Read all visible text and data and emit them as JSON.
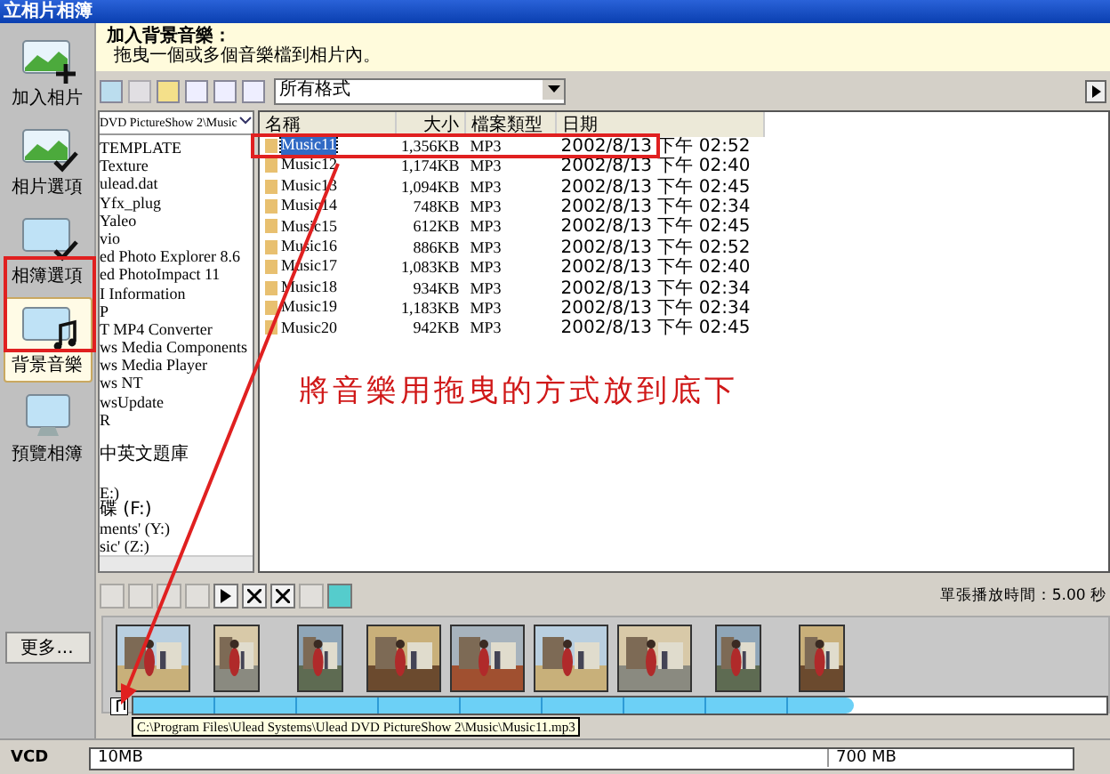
{
  "window": {
    "title": "立相片相簿"
  },
  "sidebar": {
    "items": [
      {
        "label": "加入相片",
        "selected": false
      },
      {
        "label": "相片選項",
        "selected": false
      },
      {
        "label": "相簿選項",
        "selected": false
      },
      {
        "label": "背景音樂",
        "selected": true
      },
      {
        "label": "預覽相簿",
        "selected": false
      }
    ],
    "more": "更多..."
  },
  "header": {
    "title": "加入背景音樂：",
    "hint": "拖曳一個或多個音樂檔到相片內。"
  },
  "format_filter": {
    "value": "所有格式"
  },
  "folder_tree": {
    "path": "DVD PictureShow 2\\Music",
    "items": [
      "TEMPLATE",
      "Texture",
      "ulead.dat",
      "Yfx_plug",
      "Yaleo",
      "vio",
      "ed Photo Explorer 8.6",
      "ed PhotoImpact 11",
      "I Information",
      "P",
      "T MP4 Converter",
      "ws Media Components",
      "ws Media Player",
      "ws NT",
      "wsUpdate",
      "R",
      "中英文題庫",
      "E:)",
      "碟 (F:)",
      "ments' (Y:)",
      "sic' (Z:)"
    ]
  },
  "file_list": {
    "columns": [
      "名稱",
      "大小",
      "檔案類型",
      "日期"
    ],
    "rows": [
      {
        "name": "Music11",
        "size": "1,356KB",
        "type": "MP3",
        "date": "2002/8/13 下午 02:52",
        "selected": true
      },
      {
        "name": "Music12",
        "size": "1,174KB",
        "type": "MP3",
        "date": "2002/8/13 下午 02:40",
        "selected": false
      },
      {
        "name": "Music13",
        "size": "1,094KB",
        "type": "MP3",
        "date": "2002/8/13 下午 02:45",
        "selected": false
      },
      {
        "name": "Music14",
        "size": "748KB",
        "type": "MP3",
        "date": "2002/8/13 下午 02:34",
        "selected": false
      },
      {
        "name": "Music15",
        "size": "612KB",
        "type": "MP3",
        "date": "2002/8/13 下午 02:45",
        "selected": false
      },
      {
        "name": "Music16",
        "size": "886KB",
        "type": "MP3",
        "date": "2002/8/13 下午 02:52",
        "selected": false
      },
      {
        "name": "Music17",
        "size": "1,083KB",
        "type": "MP3",
        "date": "2002/8/13 下午 02:40",
        "selected": false
      },
      {
        "name": "Music18",
        "size": "934KB",
        "type": "MP3",
        "date": "2002/8/13 下午 02:34",
        "selected": false
      },
      {
        "name": "Music19",
        "size": "1,183KB",
        "type": "MP3",
        "date": "2002/8/13 下午 02:34",
        "selected": false
      },
      {
        "name": "Music20",
        "size": "942KB",
        "type": "MP3",
        "date": "2002/8/13 下午 02:45",
        "selected": false
      }
    ]
  },
  "annotation": "將音樂用拖曳的方式放到底下",
  "slide_duration": "單張播放時間：5.00 秒",
  "music_track": {
    "level": 0.74
  },
  "tooltip": "C:\\Program Files\\Ulead Systems\\Ulead DVD PictureShow 2\\Music\\Music11.mp3",
  "status_bar": {
    "disc": "VCD",
    "used": "10MB",
    "capacity": "700 MB"
  }
}
